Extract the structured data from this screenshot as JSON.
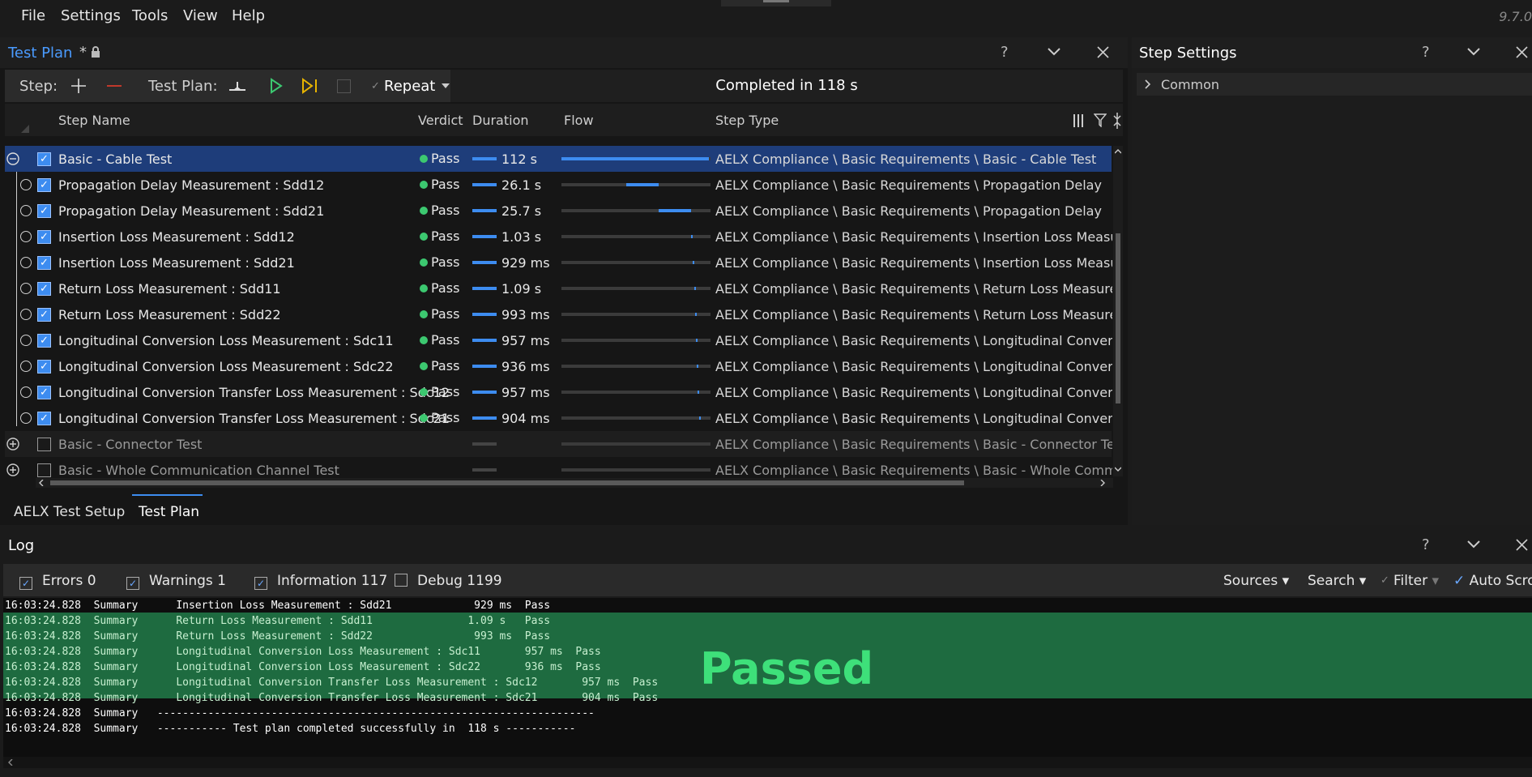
{
  "menu": [
    "File",
    "Settings",
    "Tools",
    "View",
    "Help"
  ],
  "version": "9.7.0",
  "test_plan": {
    "title": "Test Plan",
    "modified_mark": "*",
    "toolbar": {
      "step_label": "Step:",
      "plan_label": "Test Plan:",
      "repeat_label": "Repeat",
      "status": "Completed in 118 s"
    },
    "columns": {
      "name": "Step Name",
      "verdict": "Verdict",
      "duration": "Duration",
      "flow": "Flow",
      "type": "Step Type"
    },
    "rows": [
      {
        "name": "Basic - Cable Test",
        "verdict": "Pass",
        "duration": "112 s",
        "type": "AELX Compliance \\ Basic Requirements \\ Basic - Cable Test"
      },
      {
        "name": "Propagation Delay Measurement : Sdd12",
        "verdict": "Pass",
        "duration": "26.1 s",
        "type": "AELX Compliance \\ Basic Requirements \\ Propagation Delay"
      },
      {
        "name": "Propagation Delay Measurement : Sdd21",
        "verdict": "Pass",
        "duration": "25.7 s",
        "type": "AELX Compliance \\ Basic Requirements \\ Propagation Delay"
      },
      {
        "name": "Insertion Loss Measurement : Sdd12",
        "verdict": "Pass",
        "duration": "1.03 s",
        "type": "AELX Compliance \\ Basic Requirements \\ Insertion Loss Measureme"
      },
      {
        "name": "Insertion Loss Measurement : Sdd21",
        "verdict": "Pass",
        "duration": "929 ms",
        "type": "AELX Compliance \\ Basic Requirements \\ Insertion Loss Measureme"
      },
      {
        "name": "Return Loss Measurement : Sdd11",
        "verdict": "Pass",
        "duration": "1.09 s",
        "type": "AELX Compliance \\ Basic Requirements \\ Return Loss Measurement"
      },
      {
        "name": "Return Loss Measurement : Sdd22",
        "verdict": "Pass",
        "duration": "993 ms",
        "type": "AELX Compliance \\ Basic Requirements \\ Return Loss Measurement"
      },
      {
        "name": "Longitudinal Conversion Loss Measurement : Sdc11",
        "verdict": "Pass",
        "duration": "957 ms",
        "type": "AELX Compliance \\ Basic Requirements \\ Longitudinal Conversion L"
      },
      {
        "name": "Longitudinal Conversion Loss Measurement : Sdc22",
        "verdict": "Pass",
        "duration": "936 ms",
        "type": "AELX Compliance \\ Basic Requirements \\ Longitudinal Conversion L"
      },
      {
        "name": "Longitudinal Conversion Transfer Loss Measurement : Sdc12",
        "verdict": "Pass",
        "duration": "957 ms",
        "type": "AELX Compliance \\ Basic Requirements \\ Longitudinal Conversion T"
      },
      {
        "name": "Longitudinal Conversion Transfer Loss Measurement : Sdc21",
        "verdict": "Pass",
        "duration": "904 ms",
        "type": "AELX Compliance \\ Basic Requirements \\ Longitudinal Conversion T"
      },
      {
        "name": "Basic - Connector Test",
        "verdict": "",
        "duration": "",
        "type": "AELX Compliance \\ Basic Requirements \\ Basic - Connector Test"
      },
      {
        "name": "Basic - Whole Communication Channel Test",
        "verdict": "",
        "duration": "",
        "type": "AELX Compliance \\ Basic Requirements \\ Basic - Whole Communica"
      }
    ],
    "tabs": [
      "AELX Test Setup",
      "Test Plan"
    ]
  },
  "step_settings": {
    "title": "Step Settings",
    "group": "Common"
  },
  "log": {
    "title": "Log",
    "filters": {
      "errors": "Errors 0",
      "warnings": "Warnings 1",
      "information": "Information 117",
      "debug": "Debug 1199"
    },
    "right": {
      "sources": "Sources",
      "search": "Search",
      "filter": "Filter",
      "autoscroll": "Auto Scroll"
    },
    "lines": [
      "16:03:24.828  Summary      Insertion Loss Measurement : Sdd21             929 ms  Pass",
      "16:03:24.828  Summary      Return Loss Measurement : Sdd11               1.09 s   Pass",
      "16:03:24.828  Summary      Return Loss Measurement : Sdd22                993 ms  Pass",
      "16:03:24.828  Summary      Longitudinal Conversion Loss Measurement : Sdc11       957 ms  Pass",
      "16:03:24.828  Summary      Longitudinal Conversion Loss Measurement : Sdc22       936 ms  Pass",
      "16:03:24.828  Summary      Longitudinal Conversion Transfer Loss Measurement : Sdc12       957 ms  Pass",
      "16:03:24.828  Summary      Longitudinal Conversion Transfer Loss Measurement : Sdc21       904 ms  Pass",
      "16:03:24.828  Summary   ---------------------------------------------------------------------",
      "16:03:24.828  Summary   ----------- Test plan completed successfully in  118 s -----------"
    ],
    "banner": "Passed"
  },
  "colors": {
    "accent": "#3d8cf0",
    "pass": "#3cc870",
    "banner_bg": "#1e6b40",
    "banner_text": "#3ee07a"
  }
}
